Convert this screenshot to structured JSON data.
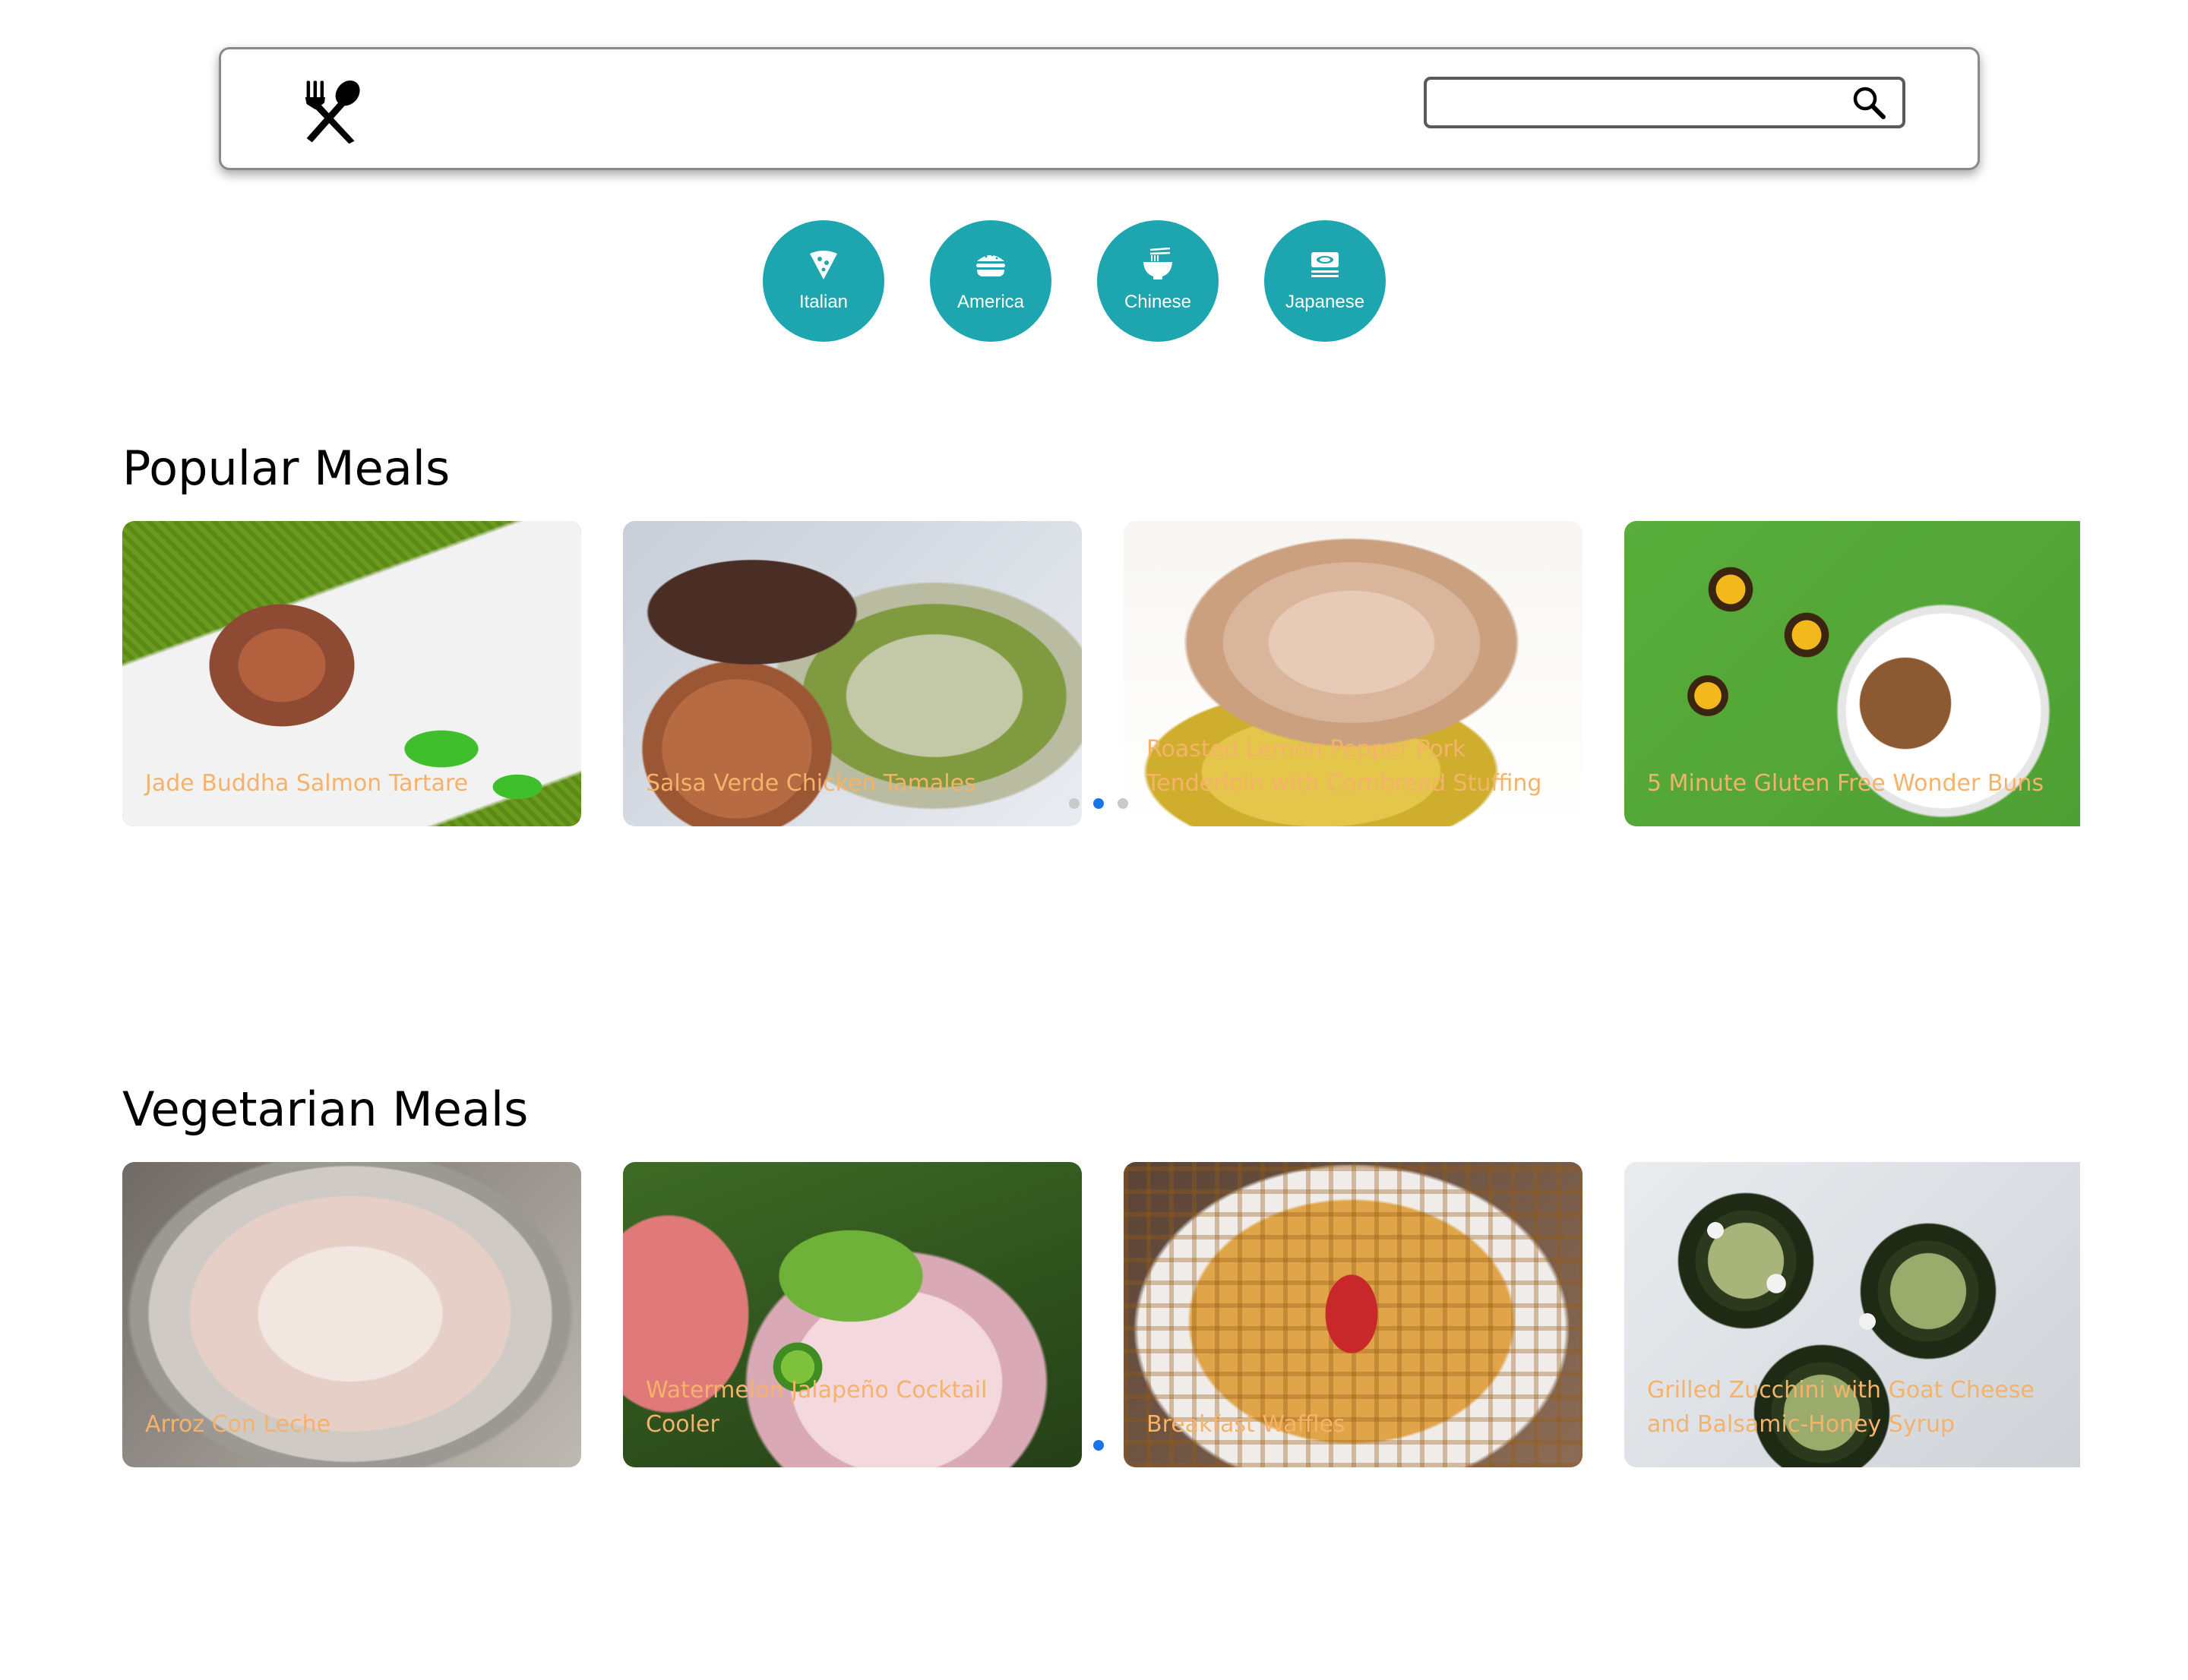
{
  "header": {
    "logo_icon": "fork-spoon-icon",
    "search": {
      "value": "",
      "placeholder": "",
      "icon": "search-icon"
    }
  },
  "cuisines": [
    {
      "label": "Italian",
      "icon": "pizza-slice-icon"
    },
    {
      "label": "America",
      "icon": "burger-icon"
    },
    {
      "label": "Chinese",
      "icon": "noodle-bowl-icon"
    },
    {
      "label": "Japanese",
      "icon": "bento-box-icon"
    }
  ],
  "colors": {
    "accent": "#1ea6b0",
    "caption": "#f4b26a",
    "dot_active": "#1a73e8",
    "dot_inactive": "#c9c9c9"
  },
  "sections": [
    {
      "title": "Popular Meals",
      "cards": [
        {
          "caption": "Jade Buddha Salmon Tartare"
        },
        {
          "caption": "Salsa Verde Chicken Tamales"
        },
        {
          "caption": "Roasted Lemon Pepper Pork Tenderloin with Cornbread Stuffing"
        },
        {
          "caption": "5 Minute Gluten Free Wonder Buns"
        }
      ],
      "dots": {
        "count": 3,
        "active": 2
      }
    },
    {
      "title": "Vegetarian Meals",
      "cards": [
        {
          "caption": "Arroz Con Leche"
        },
        {
          "caption": "Watermelon Jalapeño Cocktail Cooler"
        },
        {
          "caption": "Breakfast Waffles"
        },
        {
          "caption": "Grilled Zucchini with Goat Cheese and Balsamic-Honey Syrup"
        }
      ],
      "dots": {
        "count": 1,
        "active": 1
      }
    }
  ]
}
